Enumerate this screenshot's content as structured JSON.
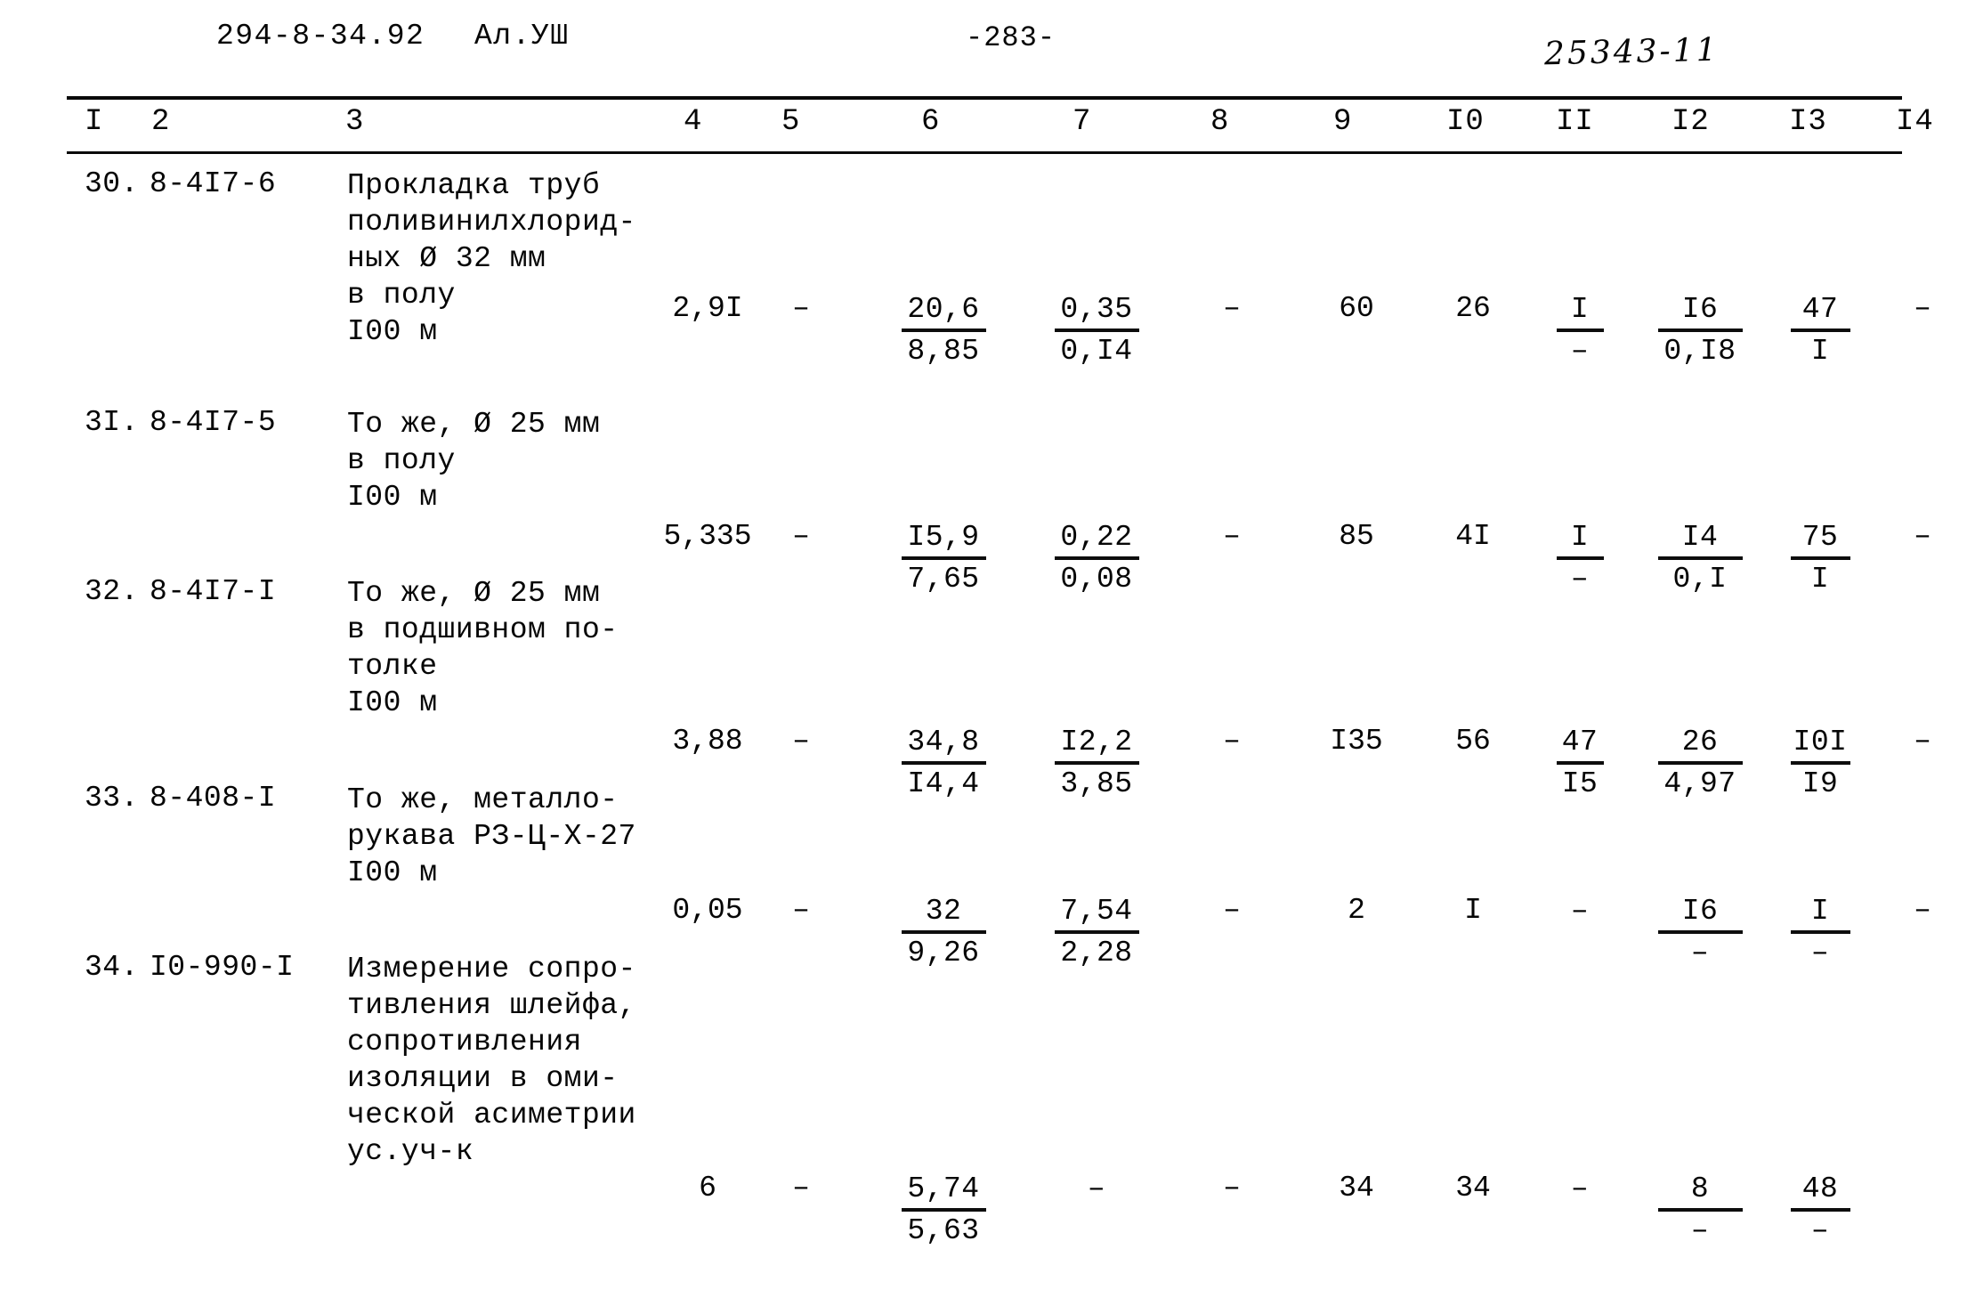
{
  "header": {
    "doc_code": "294-8-34.92",
    "album": "Ал.УШ",
    "page_number": "-283-",
    "stamp": "25343-11"
  },
  "table": {
    "column_headers": [
      "I",
      "2",
      "3",
      "4",
      "5",
      "6",
      "7",
      "8",
      "9",
      "I0",
      "II",
      "I2",
      "I3",
      "I4"
    ],
    "rows": [
      {
        "num": "30.",
        "code": "8-4I7-6",
        "description": "Прокладка труб\nполивинилхлорид-\nных Ø 32 мм\nв полу\nI00 м",
        "c4": "2,9I",
        "c5": "–",
        "c6_top": "20,6",
        "c6_bot": "8,85",
        "c7_top": "0,35",
        "c7_bot": "0,I4",
        "c8": "–",
        "c9": "60",
        "c10": "26",
        "c11_top": "I",
        "c11_bot": "–",
        "c12_top": "I6",
        "c12_bot": "0,I8",
        "c13_top": "47",
        "c13_bot": "I",
        "c14": "–"
      },
      {
        "num": "3I.",
        "code": "8-4I7-5",
        "description": "То же, Ø 25 мм\nв полу\nI00 м",
        "c4": "5,335",
        "c5": "–",
        "c6_top": "I5,9",
        "c6_bot": "7,65",
        "c7_top": "0,22",
        "c7_bot": "0,08",
        "c8": "–",
        "c9": "85",
        "c10": "4I",
        "c11_top": "I",
        "c11_bot": "–",
        "c12_top": "I4",
        "c12_bot": "0,I",
        "c13_top": "75",
        "c13_bot": "I",
        "c14": "–"
      },
      {
        "num": "32.",
        "code": "8-4I7-I",
        "description": "То же, Ø 25 мм\nв подшивном по-\nтолке\nI00 м",
        "c4": "3,88",
        "c5": "–",
        "c6_top": "34,8",
        "c6_bot": "I4,4",
        "c7_top": "I2,2",
        "c7_bot": "3,85",
        "c8": "–",
        "c9": "I35",
        "c10": "56",
        "c11_top": "47",
        "c11_bot": "I5",
        "c12_top": "26",
        "c12_bot": "4,97",
        "c13_top": "I0I",
        "c13_bot": "I9",
        "c14": "–"
      },
      {
        "num": "33.",
        "code": "8-408-I",
        "description": "То же, металло-\nрукава РЗ-Ц-Х-27\nI00 м",
        "c4": "0,05",
        "c5": "–",
        "c6_top": "32",
        "c6_bot": "9,26",
        "c7_top": "7,54",
        "c7_bot": "2,28",
        "c8": "–",
        "c9": "2",
        "c10": "I",
        "c11_top": "–",
        "c11_bot": "",
        "c12_top": "I6",
        "c12_bot": "–",
        "c13_top": "I",
        "c13_bot": "–",
        "c14": "–"
      },
      {
        "num": "34.",
        "code": "I0-990-I",
        "description": "Измерение сопро-\nтивления шлейфа,\nсопротивления\nизоляции в оми-\nческой асиметрии\nус.уч-к",
        "c4": "6",
        "c5": "–",
        "c6_top": "5,74",
        "c6_bot": "5,63",
        "c7_top": "–",
        "c7_bot": "",
        "c8": "–",
        "c9": "34",
        "c10": "34",
        "c11_top": "–",
        "c11_bot": "",
        "c12_top": "8",
        "c12_bot": "–",
        "c13_top": "48",
        "c13_bot": "–",
        "c14": ""
      }
    ]
  }
}
